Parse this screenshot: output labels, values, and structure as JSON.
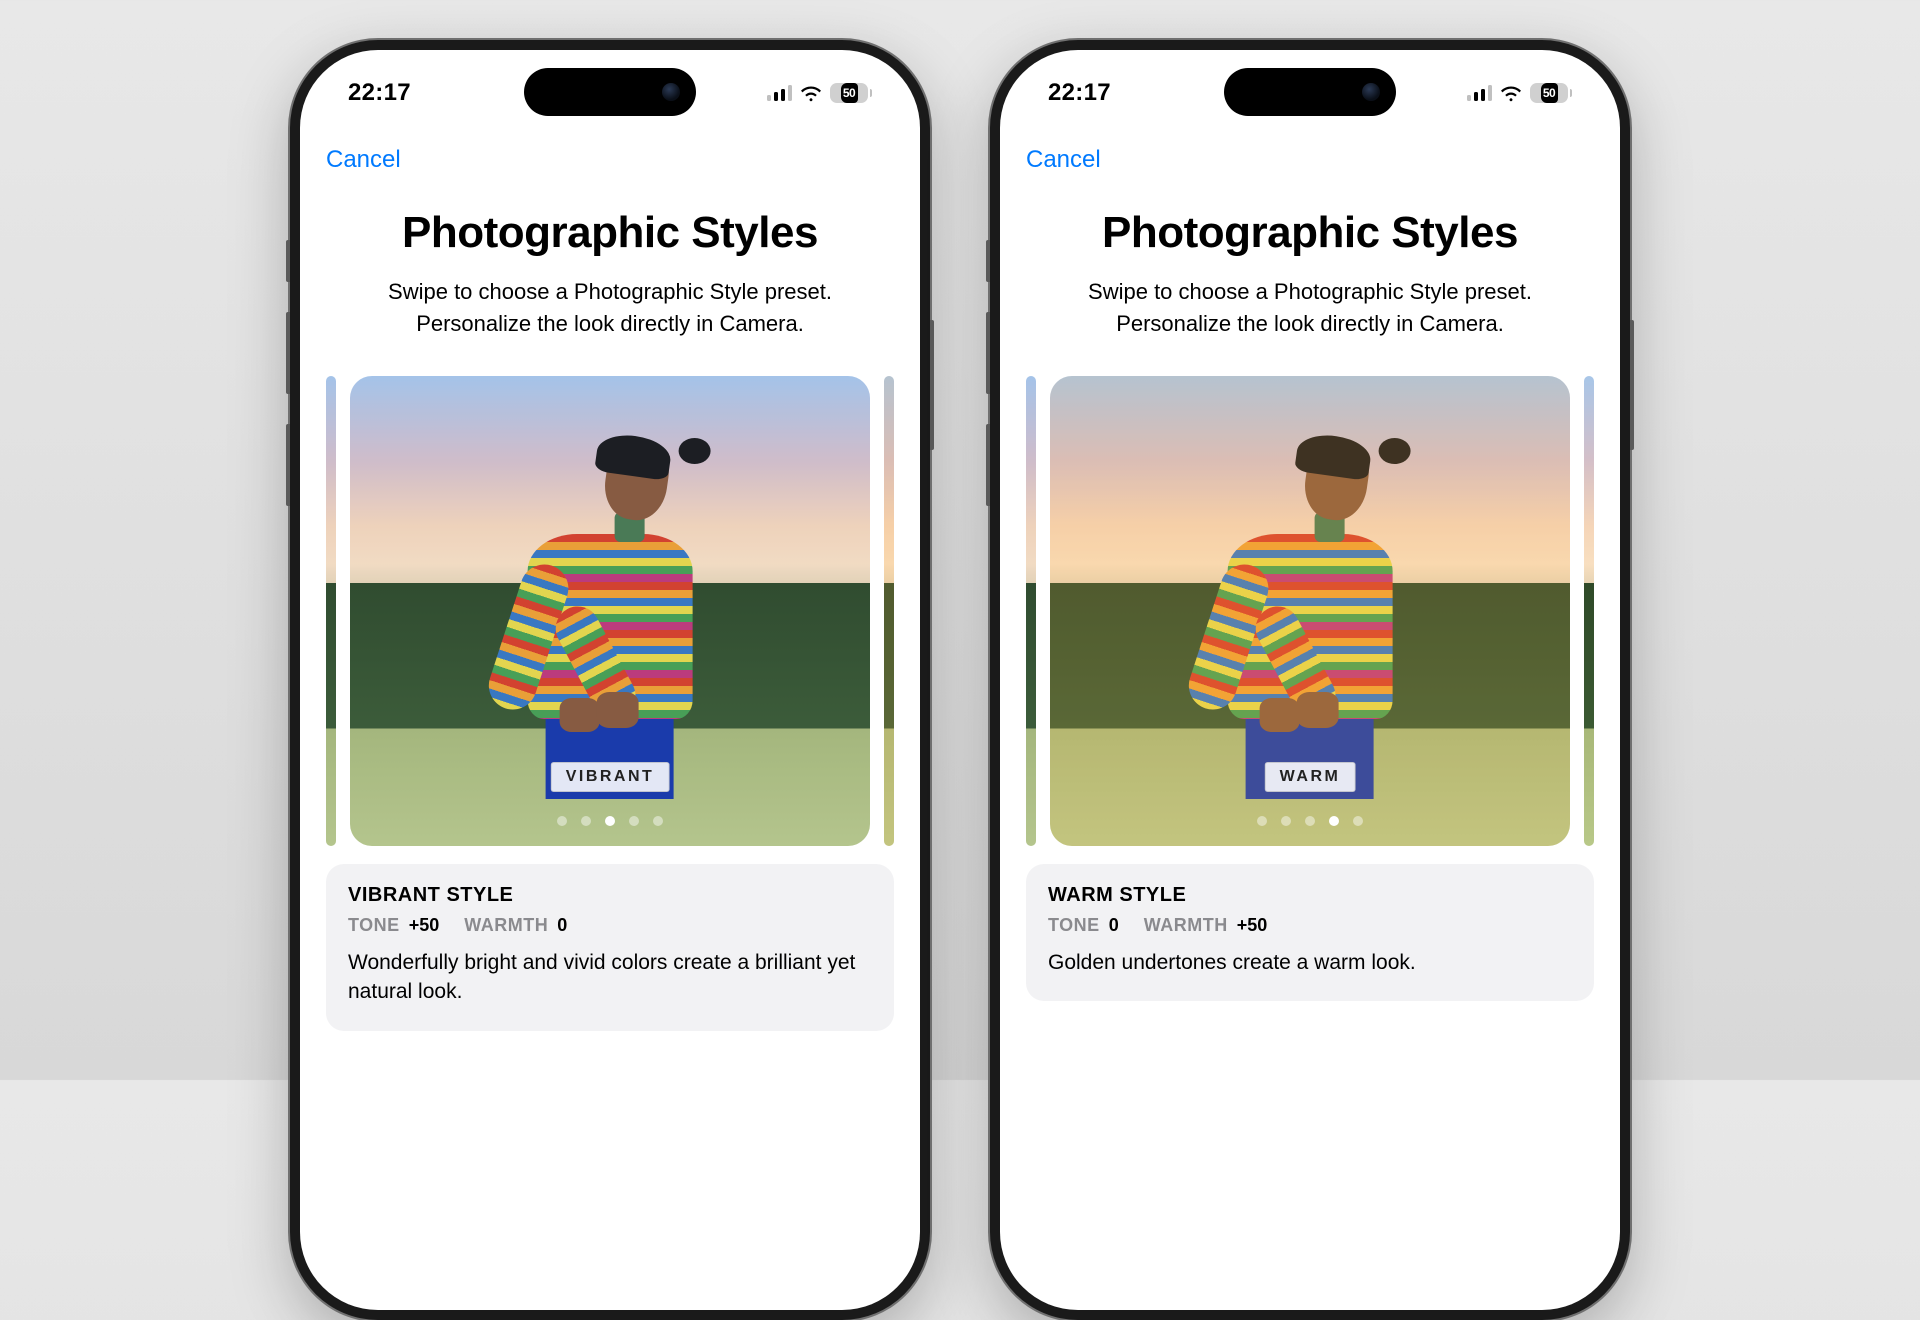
{
  "status": {
    "time": "22:17",
    "battery": "50"
  },
  "nav": {
    "cancel": "Cancel"
  },
  "page": {
    "title": "Photographic Styles",
    "subtitle_line1": "Swipe to choose a Photographic Style preset.",
    "subtitle_line2": "Personalize the look directly in Camera."
  },
  "phones": [
    {
      "style_tag": "VIBRANT",
      "active_dot_index": 2,
      "dot_count": 5,
      "info": {
        "title": "VIBRANT STYLE",
        "tone_label": "TONE",
        "tone_value": "+50",
        "warmth_label": "WARMTH",
        "warmth_value": "0",
        "description": "Wonderfully bright and vivid colors create a brilliant yet natural look."
      }
    },
    {
      "style_tag": "WARM",
      "active_dot_index": 3,
      "dot_count": 5,
      "info": {
        "title": "WARM STYLE",
        "tone_label": "TONE",
        "tone_value": "0",
        "warmth_label": "WARMTH",
        "warmth_value": "+50",
        "description": "Golden undertones create a warm look."
      }
    }
  ]
}
